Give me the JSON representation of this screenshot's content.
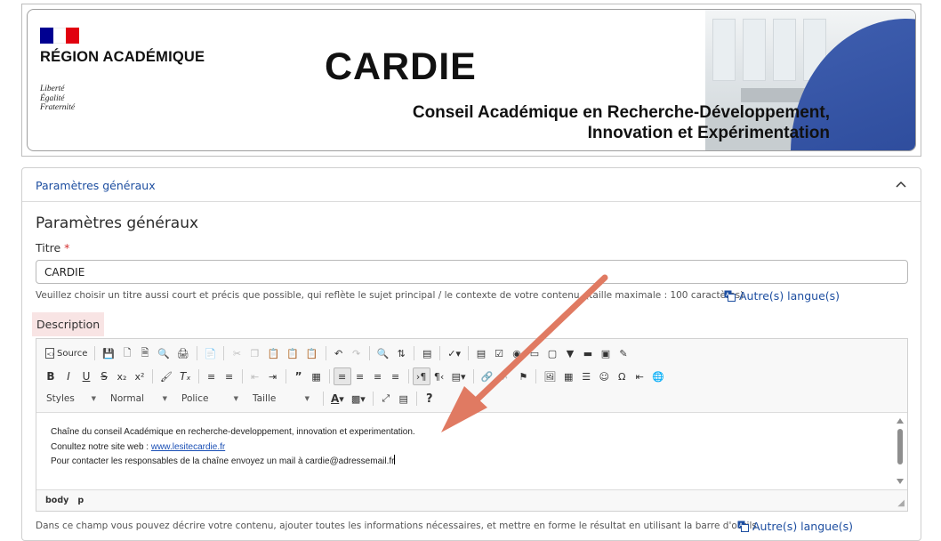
{
  "banner": {
    "region": "RÉGION ACADÉMIQUE",
    "devise": [
      "Liberté",
      "Égalité",
      "Fraternité"
    ],
    "title": "CARDIE",
    "subtitle_line1": "Conseil Académique en Recherche-Développement,",
    "subtitle_line2": "Innovation et Expérimentation"
  },
  "panel": {
    "header_label": "Paramètres généraux",
    "section_title": "Paramètres généraux",
    "titre_label": "Titre",
    "required_mark": "*",
    "titre_value": "CARDIE",
    "titre_help": "Veuillez choisir un titre aussi court et précis que possible, qui reflète le sujet principal / le contexte de votre contenu. (taille maximale : 100 caractères)",
    "lang_link": "Autre(s) langue(s)",
    "description_label": "Description",
    "description_help": "Dans ce champ vous pouvez décrire votre contenu, ajouter toutes les informations nécessaires, et mettre en forme le résultat en utilisant la barre d'outils.",
    "lang_link_2": "Autre(s) langue(s)"
  },
  "editor": {
    "source_label": "Source",
    "styles_label": "Styles",
    "format_label": "Normal",
    "font_label": "Police",
    "size_label": "Taille",
    "help_label": "?",
    "content_line1": "Chaîne du conseil Académique en recherche-developpement, innovation et experimentation.",
    "content_line2_prefix": "Conultez notre site web : ",
    "content_link": "www.lesitecardie.fr",
    "content_line3": "Pour contacter les responsables de la chaîne envoyez un mail à cardie@adressemail.fr",
    "path_body": "body",
    "path_p": "p"
  },
  "colors": {
    "accent_link": "#1d4ea0",
    "annotation_arrow": "#e07a62",
    "flag_blue": "#000091",
    "flag_red": "#e1000f"
  }
}
